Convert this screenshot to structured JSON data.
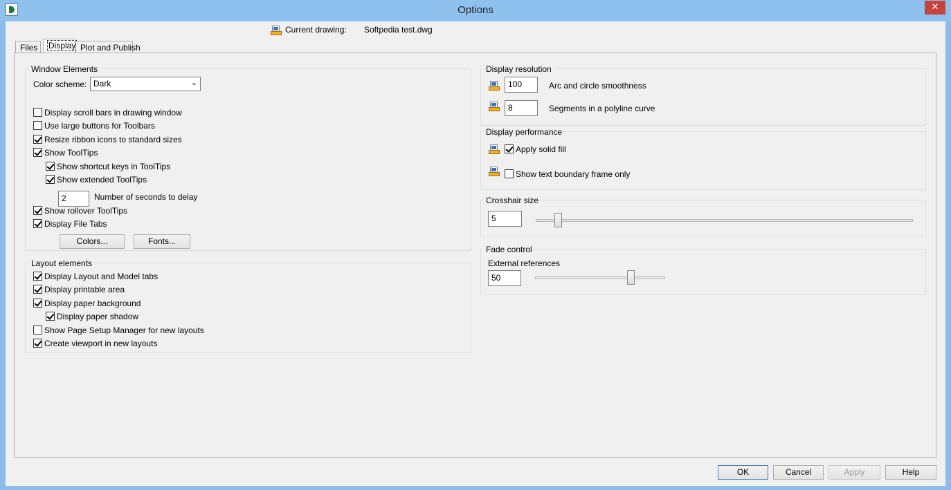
{
  "window": {
    "title": "Options",
    "close_glyph": "✕"
  },
  "header": {
    "current_drawing_label": "Current drawing:",
    "current_drawing_value": "Softpedia test.dwg"
  },
  "tabs": [
    {
      "label": "Files",
      "active": false
    },
    {
      "label": "Display",
      "active": true
    },
    {
      "label": "Plot and Publish",
      "active": false
    }
  ],
  "window_elements": {
    "title": "Window Elements",
    "color_scheme_label": "Color scheme:",
    "color_scheme_value": "Dark",
    "checkboxes": [
      {
        "label": "Display scroll bars in drawing window",
        "checked": false
      },
      {
        "label": "Use large buttons for Toolbars",
        "checked": false
      },
      {
        "label": "Resize ribbon icons to standard sizes",
        "checked": true
      },
      {
        "label": "Show ToolTips",
        "checked": true
      },
      {
        "label": "Show shortcut keys in ToolTips",
        "checked": true
      },
      {
        "label": "Show extended ToolTips",
        "checked": true
      },
      {
        "label": "Show rollover ToolTips",
        "checked": true
      },
      {
        "label": "Display File Tabs",
        "checked": true
      }
    ],
    "delay_value": "2",
    "delay_label": "Number of seconds to delay",
    "colors_button": "Colors...",
    "fonts_button": "Fonts..."
  },
  "layout_elements": {
    "title": "Layout elements",
    "checkboxes": [
      {
        "label": "Display Layout and Model tabs",
        "checked": true
      },
      {
        "label": "Display printable area",
        "checked": true
      },
      {
        "label": "Display paper background",
        "checked": true
      },
      {
        "label": "Display paper shadow",
        "checked": true
      },
      {
        "label": "Show Page Setup Manager for new layouts",
        "checked": false
      },
      {
        "label": "Create viewport in new layouts",
        "checked": true
      }
    ]
  },
  "display_resolution": {
    "title": "Display resolution",
    "arc_value": "100",
    "arc_label": "Arc and circle smoothness",
    "segments_value": "8",
    "segments_label": "Segments in a polyline curve"
  },
  "display_performance": {
    "title": "Display performance",
    "apply_solid_fill": {
      "label": "Apply solid fill",
      "checked": true
    },
    "show_text_boundary": {
      "label": "Show text boundary frame only",
      "checked": false
    }
  },
  "crosshair": {
    "title": "Crosshair size",
    "value": "5",
    "slider_fraction": 0.05
  },
  "fade_control": {
    "title": "Fade control",
    "external_refs_label": "External references",
    "value": "50",
    "slider_fraction": 0.75
  },
  "footer": {
    "ok": "OK",
    "cancel": "Cancel",
    "apply": "Apply",
    "help": "Help"
  }
}
